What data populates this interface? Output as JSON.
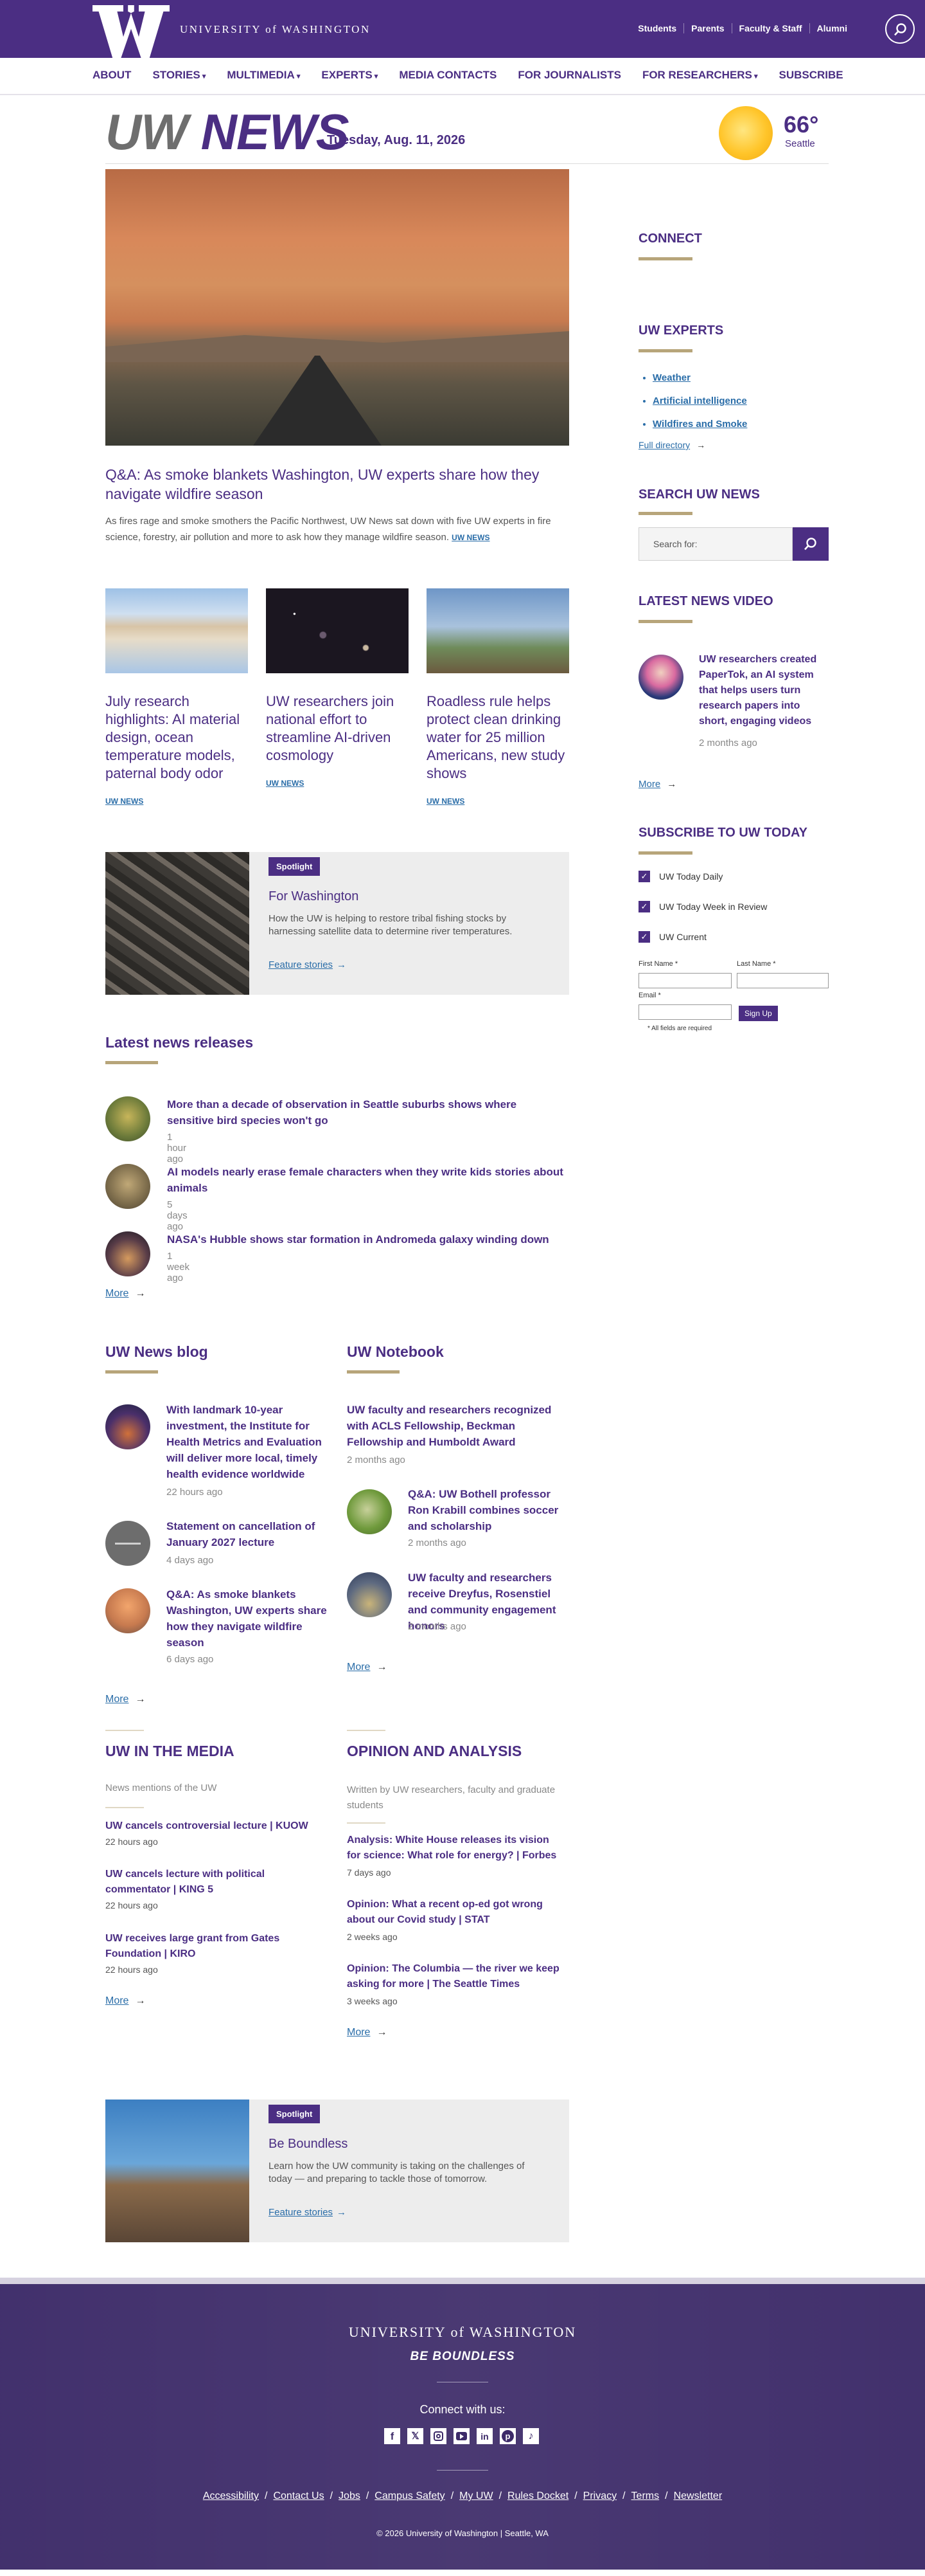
{
  "header": {
    "university": "UNIVERSITY of WASHINGTON",
    "audience_links": [
      "Students",
      "Parents",
      "Faculty & Staff",
      "Alumni"
    ]
  },
  "nav": {
    "items": [
      "ABOUT",
      "STORIES",
      "MULTIMEDIA",
      "EXPERTS",
      "MEDIA CONTACTS",
      "FOR JOURNALISTS",
      "FOR RESEARCHERS",
      "SUBSCRIBE"
    ]
  },
  "masthead": {
    "uw": "UW",
    "news": "NEWS",
    "date": "Tuesday, Aug. 11, 2026",
    "temperature": "66°",
    "city": "Seattle"
  },
  "hero": {
    "title": "Q&A: As smoke blankets Washington, UW experts share how they navigate wildfire season",
    "summary": "As fires rage and smoke smothers the Pacific Northwest, UW News sat down with five UW experts in fire science, forestry, air pollution and more to ask how they manage wildfire season.",
    "tag": "UW NEWS"
  },
  "cards": [
    {
      "title": "July research highlights: AI material design, ocean temperature models, paternal body odor",
      "tag": "UW NEWS"
    },
    {
      "title": "UW researchers join national effort to streamline AI-driven cosmology",
      "tag": "UW NEWS"
    },
    {
      "title": "Roadless rule helps protect clean drinking water for 25 million Americans, new study shows",
      "tag": "UW NEWS"
    }
  ],
  "spotlight1": {
    "badge": "Spotlight",
    "title": "For Washington",
    "desc": "How the UW is helping to restore tribal fishing stocks by harnessing satellite data to determine river temperatures.",
    "link": "Feature stories"
  },
  "latest": {
    "title": "Latest news releases",
    "items": [
      {
        "title": "More than a decade of observation in Seattle suburbs shows where sensitive bird species won't go",
        "time": "1 hour ago"
      },
      {
        "title": "AI models nearly erase female characters when they write kids stories about animals",
        "time": "5 days ago"
      },
      {
        "title": "NASA's Hubble shows star formation in Andromeda galaxy winding down",
        "time": "1 week ago"
      }
    ],
    "more": "More"
  },
  "blog": {
    "title": "UW News blog",
    "items": [
      {
        "title": "With landmark 10-year investment, the Institute for Health Metrics and Evaluation will deliver more local, timely health evidence worldwide",
        "time": "22 hours ago"
      },
      {
        "title": "Statement on cancellation of January 2027 lecture",
        "time": "4 days ago"
      },
      {
        "title": "Q&A: As smoke blankets Washington, UW experts share how they navigate wildfire season",
        "time": "6 days ago"
      }
    ],
    "more": "More"
  },
  "notebook": {
    "title": "UW Notebook",
    "items": [
      {
        "title": "UW faculty and researchers recognized with ACLS Fellowship, Beckman Fellowship and Humboldt Award",
        "time": "2 months ago"
      },
      {
        "title": "Q&A: UW Bothell professor Ron Krabill combines soccer and scholarship",
        "time": "2 months ago"
      },
      {
        "title": "UW faculty and researchers receive Dreyfus, Rosenstiel and community engagement honors",
        "time": "2 months ago"
      }
    ],
    "more": "More"
  },
  "media": {
    "title": "UW IN THE MEDIA",
    "subtitle": "News mentions of the UW",
    "items": [
      {
        "title": "UW cancels controversial lecture | KUOW",
        "time": "22 hours ago"
      },
      {
        "title": "UW cancels lecture with political commentator | KING 5",
        "time": "22 hours ago"
      },
      {
        "title": "UW receives large grant from Gates Foundation | KIRO",
        "time": "22 hours ago"
      }
    ],
    "more": "More"
  },
  "opinion": {
    "title": "OPINION AND ANALYSIS",
    "subtitle": "Written by UW researchers, faculty and graduate students",
    "items": [
      {
        "title": "Analysis: White House releases its vision for science: What role for energy? | Forbes",
        "time": "7 days ago"
      },
      {
        "title": "Opinion: What a recent op-ed got wrong about our Covid study | STAT",
        "time": "2 weeks ago"
      },
      {
        "title": "Opinion: The Columbia — the river we keep asking for more | The Seattle Times",
        "time": "3 weeks ago"
      }
    ],
    "more": "More"
  },
  "spotlight2": {
    "badge": "Spotlight",
    "title": "Be Boundless",
    "desc": "Learn how the UW community is taking on the challenges of today — and preparing to tackle those of tomorrow.",
    "link": "Feature stories"
  },
  "sidebar": {
    "connect": "CONNECT",
    "experts_title": "UW EXPERTS",
    "experts": [
      "Weather",
      "Artificial intelligence",
      "Wildfires and Smoke"
    ],
    "full_directory": "Full directory",
    "search_title": "SEARCH UW NEWS",
    "search_placeholder": "Search for:",
    "video_title": "LATEST NEWS VIDEO",
    "video_caption": "UW researchers created PaperTok, an AI system that helps users turn research papers into short, engaging videos",
    "video_time": "2 months ago",
    "video_more": "More",
    "subscribe_title": "SUBSCRIBE TO UW TODAY",
    "options": [
      "UW Today Daily",
      "UW Today Week in Review",
      "UW Current"
    ],
    "first_name": "First Name *",
    "last_name": "Last Name *",
    "email": "Email *",
    "required_note": "* All fields are required",
    "signup": "Sign Up"
  },
  "footer": {
    "university": "UNIVERSITY of WASHINGTON",
    "tagline": "BE BOUNDLESS",
    "connect": "Connect with us:",
    "links": [
      "Accessibility",
      "Contact Us",
      "Jobs",
      "Campus Safety",
      "My UW",
      "Rules Docket",
      "Privacy",
      "Terms",
      "Newsletter"
    ],
    "copyright": "© 2026 University of Washington | Seattle, WA"
  },
  "colors": {
    "brand_purple": "#4b2e83",
    "gold": "#b7a57a",
    "link_blue": "#2a6da8"
  }
}
